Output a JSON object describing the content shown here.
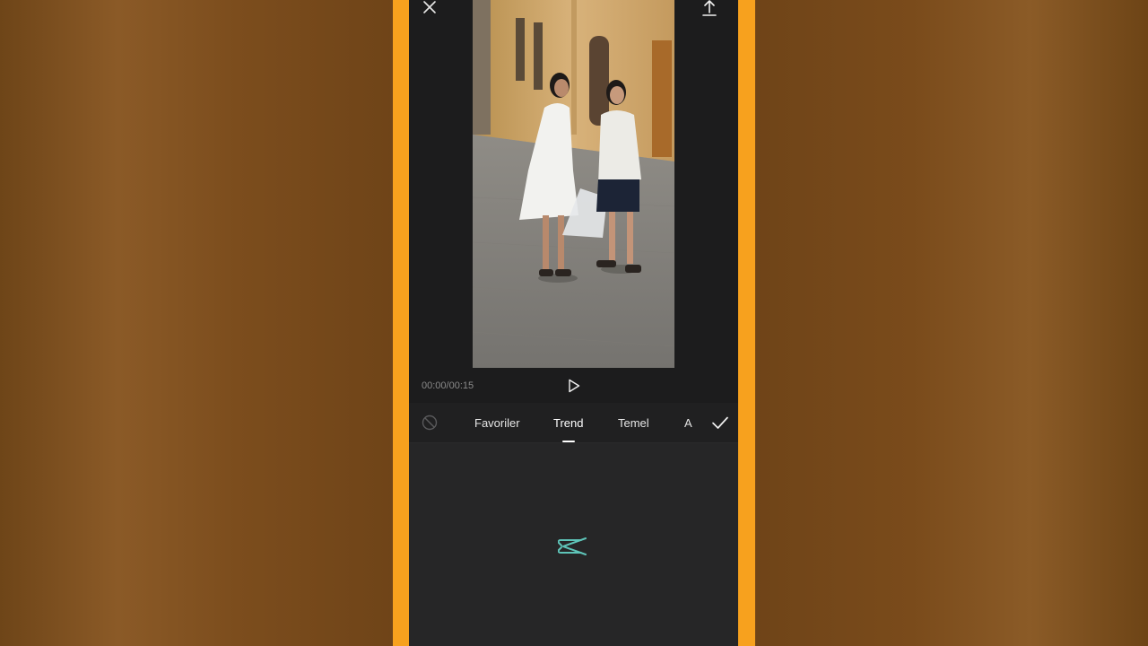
{
  "player": {
    "time": "00:00/00:15"
  },
  "tabs": [
    {
      "label": "Favoriler"
    },
    {
      "label": "Trend"
    },
    {
      "label": "Temel"
    },
    {
      "label": "A"
    }
  ],
  "colors": {
    "accent_frame": "#f7a11e",
    "app_background": "#1c1c1d",
    "panel_background": "#262627",
    "logo": "#5ec4b8"
  },
  "icons": {
    "close": "close-icon",
    "fullscreen": "fullscreen-icon",
    "export": "export-icon",
    "play": "play-icon",
    "no_effect": "no-effect-icon",
    "confirm": "checkmark-icon",
    "logo": "capcut-logo"
  }
}
